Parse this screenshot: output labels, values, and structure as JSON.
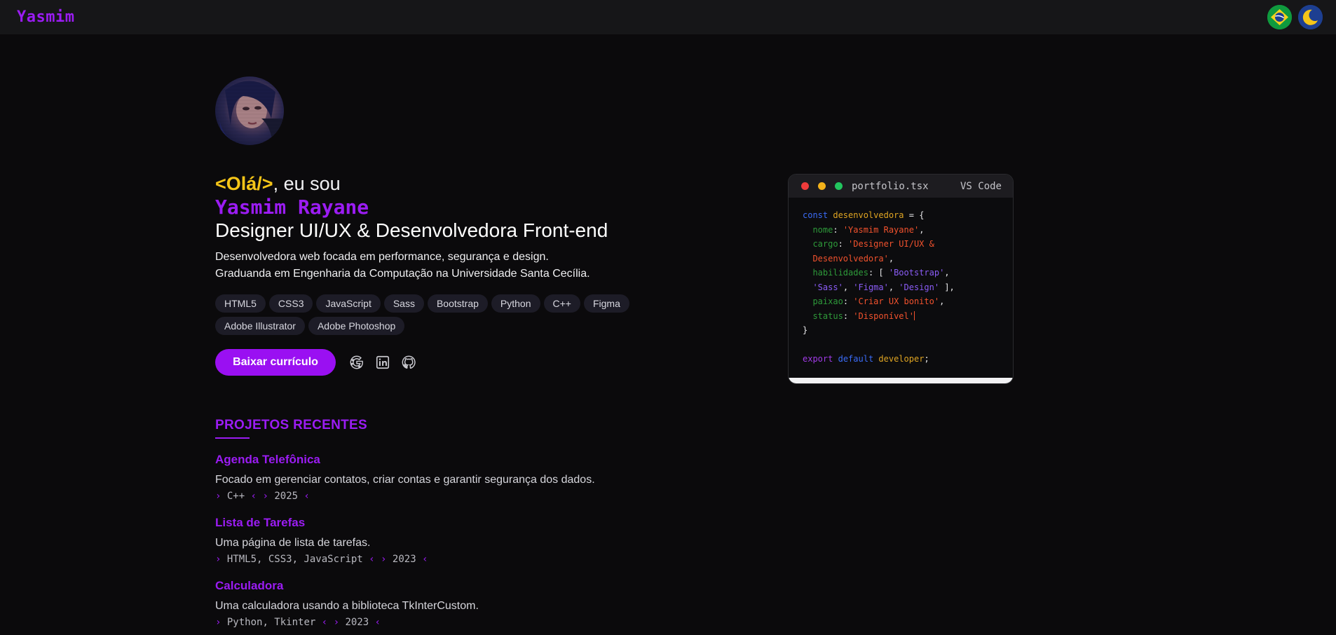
{
  "navbar": {
    "brand": "Yasmim",
    "language_icon": "brazil-flag-icon",
    "theme_icon": "moon-icon"
  },
  "hero": {
    "greeting_highlight": "<Olá/>",
    "greeting_rest": ", eu sou",
    "name": "Yasmim Rayane",
    "role": "Designer UI/UX & Desenvolvedora Front-end",
    "bio_line1": "Desenvolvedora web focada em performance, segurança e design.",
    "bio_line2": "Graduanda em Engenharia da Computação na Universidade Santa Cecília.",
    "skills": [
      "HTML5",
      "CSS3",
      "JavaScript",
      "Sass",
      "Bootstrap",
      "Python",
      "C++",
      "Figma",
      "Adobe Illustrator",
      "Adobe Photoshop"
    ],
    "cv_button": "Baixar currículo",
    "social_icons": [
      "google-icon",
      "linkedin-icon",
      "github-icon"
    ]
  },
  "code_card": {
    "file_name": "portfolio.tsx",
    "editor_name": "VS Code",
    "lines": {
      "l1_kw": "const",
      "l1_var": "desenvolvedora",
      "l1_rest": " = {",
      "l2_key": "nome",
      "l2_val": "'Yasmim Rayane'",
      "l3_key": "cargo",
      "l3_val1": "'Designer UI/UX &",
      "l4_val2": "Desenvolvedora'",
      "l5_key": "habilidades",
      "l5_v1": "'Bootstrap'",
      "l6_v1": "'Sass'",
      "l6_v2": "'Figma'",
      "l6_v3": "'Design'",
      "l7_key": "paixao",
      "l7_val": "'Criar UX bonito'",
      "l8_key": "status",
      "l8_val": "'Disponível'",
      "l9": "}",
      "l11_kw1": "export",
      "l11_kw2": "default",
      "l11_var": "developer"
    },
    "colors": {
      "keyword": "#3b6cf7",
      "variable": "#e0a522",
      "property": "#2e9a3a",
      "string": "#f2522d"
    }
  },
  "projects": {
    "section_title": "PROJETOS RECENTES",
    "items": [
      {
        "title": "Agenda Telefônica",
        "desc": "Focado em gerenciar contatos, criar contas e garantir segurança dos dados.",
        "tech": "C++",
        "year": "2025"
      },
      {
        "title": "Lista de Tarefas",
        "desc": "Uma página de lista de tarefas.",
        "tech": "HTML5, CSS3, JavaScript",
        "year": "2023"
      },
      {
        "title": "Calculadora",
        "desc": "Uma calculadora usando a biblioteca TkInterCustom.",
        "tech": "Python, Tkinter",
        "year": "2023"
      }
    ]
  },
  "theme_colors": {
    "accent": "#9b1cf3",
    "highlight": "#f5c518",
    "background": "#0b0a0c"
  }
}
